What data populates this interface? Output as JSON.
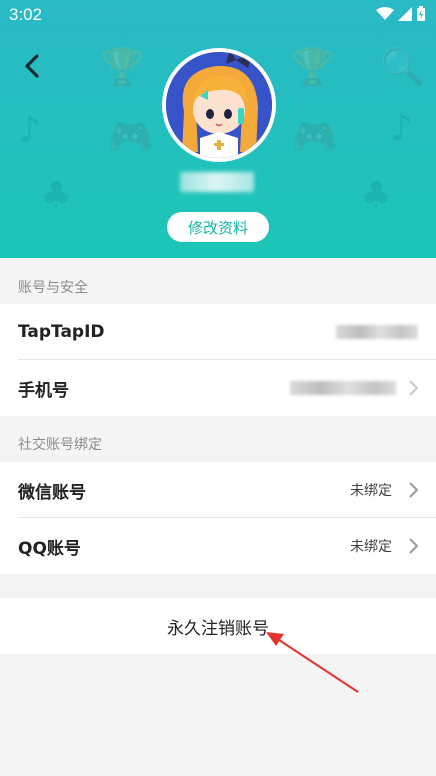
{
  "status_bar": {
    "time": "3:02"
  },
  "header": {
    "edit_profile_label": "修改资料",
    "bg_colors": [
      "#2ab9c6",
      "#1cc6b6"
    ]
  },
  "account_security": {
    "title": "账号与安全",
    "rows": [
      {
        "label": "TapTapID"
      },
      {
        "label": "手机号"
      }
    ]
  },
  "social_binding": {
    "title": "社交账号绑定",
    "rows": [
      {
        "label": "微信账号",
        "value": "未绑定"
      },
      {
        "label": "QQ账号",
        "value": "未绑定"
      }
    ]
  },
  "delete_account": {
    "label": "永久注销账号"
  },
  "colors": {
    "accent": "#15b3a4",
    "arrow": "#e3342f"
  }
}
